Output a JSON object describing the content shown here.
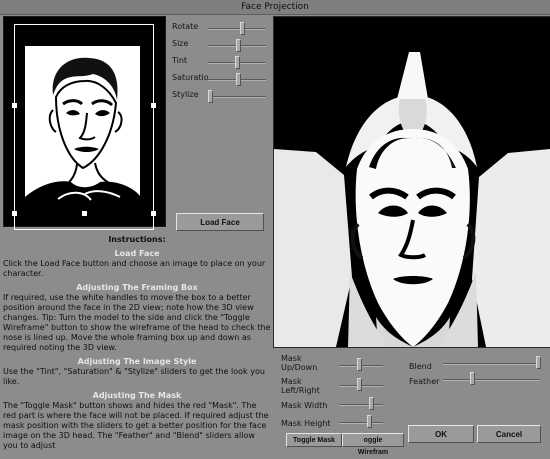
{
  "window": {
    "title": "Face Projection"
  },
  "sliders": [
    {
      "label": "Rotate",
      "value": 0.58
    },
    {
      "label": "Size",
      "value": 0.52
    },
    {
      "label": "Tint",
      "value": 0.5
    },
    {
      "label": "Saturatio",
      "value": 0.52
    },
    {
      "label": "Stylize",
      "value": 0.04
    }
  ],
  "buttons": {
    "load_face": "Load Face",
    "toggle_mask": "Toggle Mask",
    "toggle_wireframe": "oggle Wirefram",
    "ok": "OK",
    "cancel": "Cancel"
  },
  "instructions": {
    "heading": "Instructions:",
    "sections": [
      {
        "title": "Load Face",
        "text": "Click the Load Face button and choose an image to place on your character."
      },
      {
        "title": "Adjusting The Framing Box",
        "text": "If required, use the white handles to move the box to a better position around the face in the 2D view; note how the 3D view changes. Tip: Turn the model to the side and click the \"Toggle Wireframe\" button to show the wireframe of the head to check the nose is lined up.  Move the whole framing box up and down as required noting the 3D view."
      },
      {
        "title": "Adjusting The Image Style",
        "text": "Use the \"Tint\", \"Saturation\" & \"Stylize\" sliders to get the look you like."
      },
      {
        "title": "Adjusting The Mask",
        "text": "The \"Toggle Mask\" button shows and hides the red \"Mask\".  The red part is where the face will not be placed.  If required adjust the mask position with the sliders to get a better position for the face image on the 3D head.  The \"Feather\" and \"Blend\" sliders allow you to adjust"
      }
    ]
  },
  "mask_sliders": {
    "up_down": {
      "label_line1": "Mask",
      "label_line2": "Up/Down",
      "value": 0.46
    },
    "left_right": {
      "label_line1": "Mask",
      "label_line2": "Left/Right",
      "value": 0.46
    },
    "width": {
      "label": "Mask Width",
      "value": 0.72
    },
    "height": {
      "label": "Mask Height",
      "value": 0.68
    },
    "blend": {
      "label": "Blend",
      "value": 0.98
    },
    "feather": {
      "label": "Feather",
      "value": 0.3
    }
  }
}
